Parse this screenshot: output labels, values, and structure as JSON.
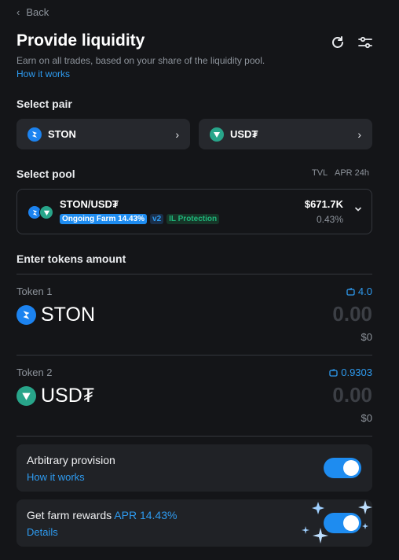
{
  "header": {
    "back_label": "Back",
    "title": "Provide liquidity",
    "subtitle": "Earn on all trades, based on your share of the liquidity pool.",
    "how_it_works": "How it works"
  },
  "select_pair": {
    "label": "Select pair",
    "token_a": "STON",
    "token_b": "USD₮"
  },
  "select_pool": {
    "label": "Select pool",
    "col_tvl": "TVL",
    "col_apr": "APR 24h",
    "pool_name": "STON/USD₮",
    "farm_badge": "Ongoing Farm 14.43%",
    "version_badge": "v2",
    "il_badge": "IL Protection",
    "tvl_value": "$671.7K",
    "apr_value": "0.43%"
  },
  "tokens": {
    "label": "Enter tokens amount",
    "token1": {
      "label": "Token 1",
      "symbol": "STON",
      "balance": "4.0",
      "amount": "0.00",
      "usd": "$0"
    },
    "token2": {
      "label": "Token 2",
      "symbol": "USD₮",
      "balance": "0.9303",
      "amount": "0.00",
      "usd": "$0"
    }
  },
  "options": {
    "arbitrary": {
      "title": "Arbitrary provision",
      "link": "How it works",
      "enabled": true
    },
    "farm": {
      "title": "Get farm rewards",
      "apr": "APR 14.43%",
      "link": "Details",
      "enabled": true
    }
  },
  "colors": {
    "accent": "#1e8cf0",
    "link": "#2e9bf0",
    "ston": "#1c83f0",
    "usdt": "#28a58a",
    "il_green": "#1fb57a"
  },
  "icons": [
    "chevron-left-icon",
    "refresh-icon",
    "settings-sliders-icon",
    "ston-logo-icon",
    "usdt-logo-icon",
    "chevron-right-icon",
    "chevron-down-icon",
    "wallet-icon",
    "sparkle-icon"
  ]
}
